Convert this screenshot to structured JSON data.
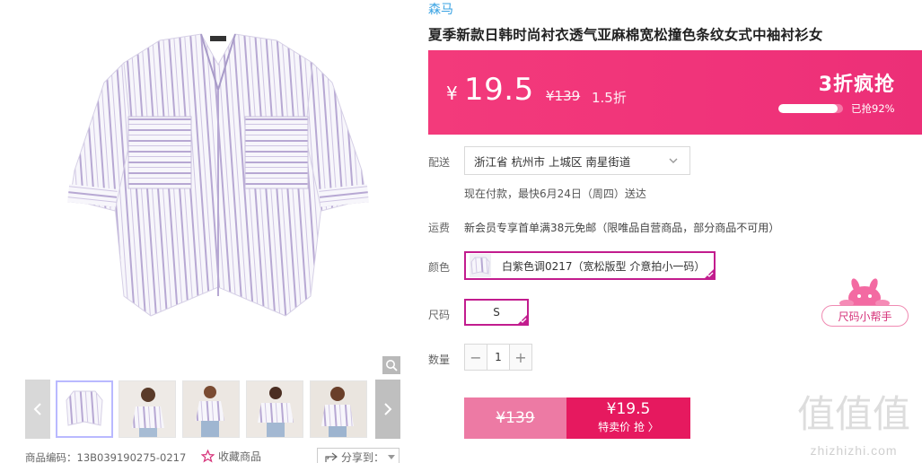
{
  "brand": "森马",
  "title": "夏季新款日韩时尚衬衣透气亚麻棉宽松撞色条纹女式中袖衬衫女",
  "price_banner": {
    "currency": "¥",
    "price": "19.5",
    "original_price": "¥139",
    "discount": "1.5折",
    "slogan": "3折疯抢",
    "sold_text": "已抢92%",
    "sold_percent": 92
  },
  "delivery": {
    "label": "配送",
    "location": "浙江省 杭州市 上城区 南星街道",
    "note": "现在付款，最快6月24日（周四）送达"
  },
  "freight": {
    "label": "运费",
    "text": "新会员专享首单满38元免邮（限唯品自营商品，部分商品不可用）"
  },
  "color": {
    "label": "颜色",
    "selected": "白紫色调0217（宽松版型 介意拍小一码）"
  },
  "size": {
    "label": "尺码",
    "selected": "S"
  },
  "quantity": {
    "label": "数量",
    "value": "1",
    "minus": "−",
    "plus": "+"
  },
  "buy": {
    "original": "¥139",
    "price": "¥19.5",
    "label": "特卖价 抢 〉"
  },
  "size_helper": "尺码小帮手",
  "gallery": {
    "sku": "商品编码：13B039190275-0217",
    "favorite": "收藏商品",
    "share": "分享到：",
    "thumb_count": 5
  },
  "watermark": {
    "glyphs": "值值值",
    "site": "zhizhizhi.com"
  },
  "colors": {
    "accent": "#f0337a",
    "buy": "#e6195f",
    "option_border": "#c21c8e",
    "brand_link": "#3aa3e3"
  }
}
